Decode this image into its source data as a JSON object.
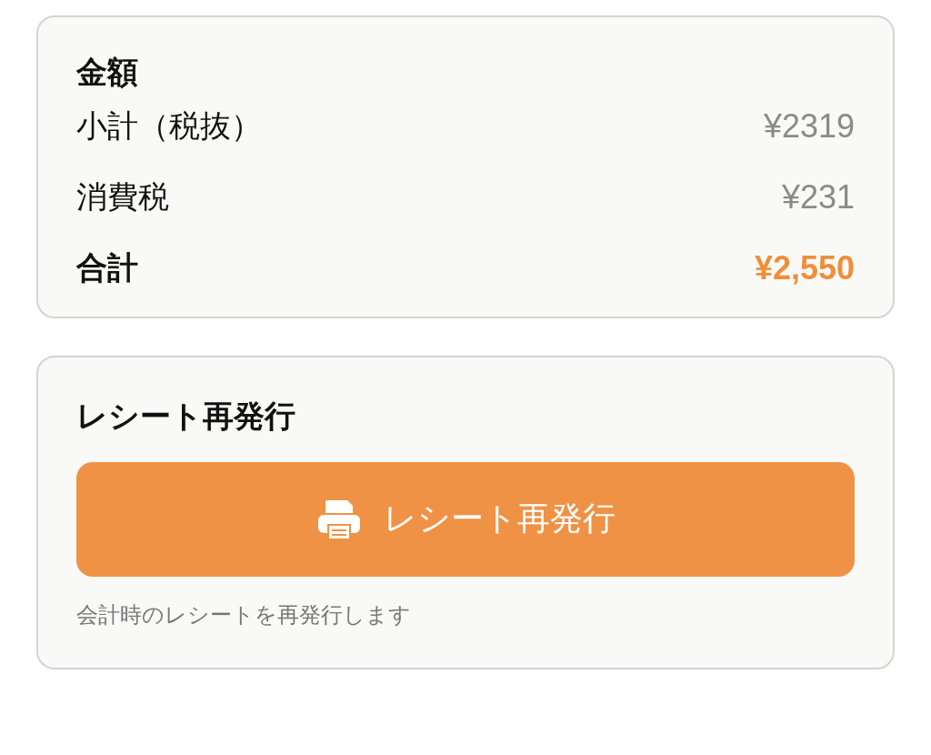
{
  "amount_card": {
    "title": "金額",
    "rows": [
      {
        "kind": "normal",
        "label": "小計（税抜）",
        "value": "¥2319"
      },
      {
        "kind": "normal",
        "label": "消費税",
        "value": "¥231"
      },
      {
        "kind": "total",
        "label": "合計",
        "value": "¥2,550"
      }
    ]
  },
  "reissue_card": {
    "title": "レシート再発行",
    "button": "レシート再発行",
    "note": "会計時のレシートを再発行します"
  }
}
